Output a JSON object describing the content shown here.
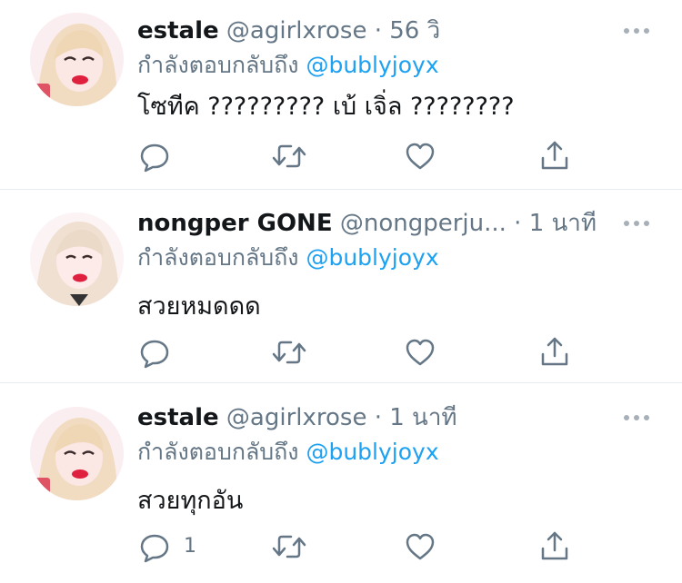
{
  "tweets": [
    {
      "name": "estale",
      "handle": "@agirlxrose",
      "separator": "·",
      "time": "56 วิ",
      "reply_prefix": "กำลังตอบกลับถึง",
      "reply_to": "@bublyjoyx",
      "text": "โซทีค ????????? เบ้ เจิ่ล ????????",
      "reply_count": "",
      "icons": [
        "reply-icon",
        "retweet-icon",
        "like-icon",
        "share-icon",
        "more-icon"
      ]
    },
    {
      "name": "nongper GONE",
      "handle": "@nongperju...",
      "separator": "·",
      "time": "1 นาที",
      "reply_prefix": "กำลังตอบกลับถึง",
      "reply_to": "@bublyjoyx",
      "text": "สวยหมดดด",
      "reply_count": "",
      "icons": [
        "reply-icon",
        "retweet-icon",
        "like-icon",
        "share-icon",
        "more-icon"
      ]
    },
    {
      "name": "estale",
      "handle": "@agirlxrose",
      "separator": "·",
      "time": "1 นาที",
      "reply_prefix": "กำลังตอบกลับถึง",
      "reply_to": "@bublyjoyx",
      "text": "สวยทุกอัน",
      "reply_count": "1",
      "icons": [
        "reply-icon",
        "retweet-icon",
        "like-icon",
        "share-icon",
        "more-icon"
      ]
    }
  ],
  "colors": {
    "text": "#14171a",
    "secondary": "#657786",
    "link": "#1da1f2",
    "icon": "#657786",
    "divider": "#e6ecf0"
  }
}
